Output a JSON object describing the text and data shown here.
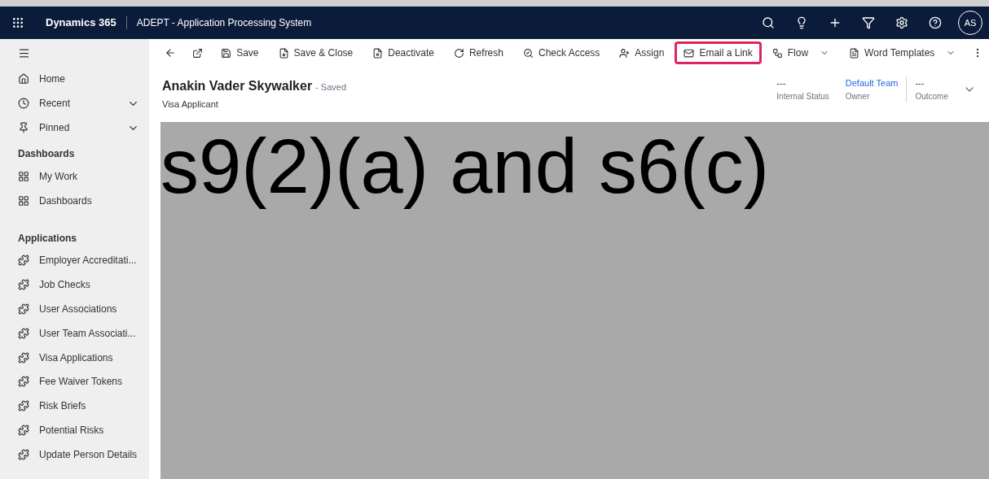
{
  "header": {
    "app_name": "Dynamics 365",
    "title": "ADEPT - Application Processing System",
    "avatar": "AS"
  },
  "toolbar": [
    {
      "label": "Save",
      "highlighted": false,
      "dropdown": false
    },
    {
      "label": "Save & Close",
      "highlighted": false,
      "dropdown": false
    },
    {
      "label": "Deactivate",
      "highlighted": false,
      "dropdown": false
    },
    {
      "label": "Refresh",
      "highlighted": false,
      "dropdown": false
    },
    {
      "label": "Check Access",
      "highlighted": false,
      "dropdown": false
    },
    {
      "label": "Assign",
      "highlighted": false,
      "dropdown": false
    },
    {
      "label": "Email a Link",
      "highlighted": true,
      "dropdown": false
    },
    {
      "label": "Flow",
      "highlighted": false,
      "dropdown": true
    },
    {
      "label": "Word Templates",
      "highlighted": false,
      "dropdown": true
    }
  ],
  "sidebar": {
    "top_items": [
      {
        "label": "Home",
        "expandable": false
      },
      {
        "label": "Recent",
        "expandable": true
      },
      {
        "label": "Pinned",
        "expandable": true
      }
    ],
    "sections": [
      {
        "heading": "Dashboards",
        "items": [
          "My Work",
          "Dashboards"
        ]
      },
      {
        "heading": "Applications",
        "items": [
          "Employer Accreditati...",
          "Job Checks",
          "User Associations",
          "User Team Associati...",
          "Visa Applications",
          "Fee Waiver Tokens",
          "Risk Briefs",
          "Potential Risks",
          "Update Person Details"
        ]
      }
    ]
  },
  "record": {
    "name": "Anakin Vader Skywalker",
    "status": "- Saved",
    "entity": "Visa Applicant",
    "fields": [
      {
        "value": "---",
        "label": "Internal Status",
        "link": false
      },
      {
        "value": "Default Team",
        "label": "Owner",
        "link": true
      },
      {
        "value": "---",
        "label": "Outcome",
        "link": false
      }
    ]
  },
  "redaction": {
    "label": "s9(2)(a) and s6(c)"
  }
}
